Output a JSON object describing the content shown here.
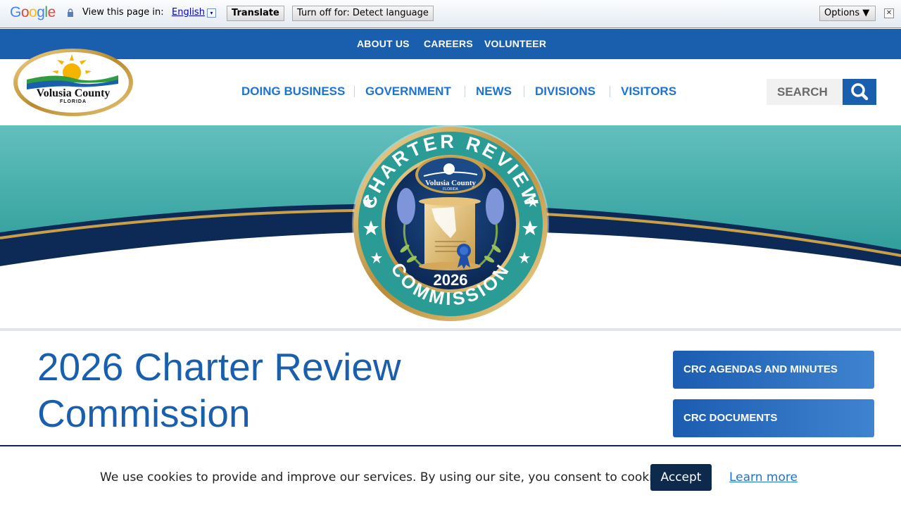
{
  "translate_bar": {
    "logo": "Google",
    "view_label": "View this page in:",
    "language": "English",
    "language_caret": "▾",
    "translate_button": "Translate",
    "turn_off_button": "Turn off for: Detect language",
    "options_button": "Options ▼",
    "close_glyph": "✕"
  },
  "utility_nav": {
    "items": [
      "ABOUT US",
      "CAREERS",
      "VOLUNTEER"
    ]
  },
  "header": {
    "logo_name": "Volusia County",
    "logo_state": "FLORIDA",
    "nav": [
      "DOING BUSINESS",
      "GOVERNMENT",
      "NEWS",
      "DIVISIONS",
      "VISITORS"
    ],
    "search_label": "SEARCH"
  },
  "hero": {
    "seal_top_text": "CHARTER REVIEW",
    "seal_bottom_text": "COMMISSION",
    "seal_year": "2026",
    "seal_logo_name": "Volusia County",
    "seal_logo_state": "FLORIDA"
  },
  "main": {
    "title_line1": "2026 Charter Review",
    "title_line2": "Commission",
    "side_buttons": [
      "CRC AGENDAS AND MINUTES",
      "CRC DOCUMENTS"
    ]
  },
  "cookie_banner": {
    "message": "We use cookies to provide and improve our services. By using our site, you consent to cookies.",
    "accept": "Accept",
    "learn_more": "Learn more"
  },
  "colors": {
    "brand_blue": "#1a5fae",
    "link_blue": "#1e73d2",
    "navy": "#0d2a4d",
    "teal": "#3aa9a7",
    "gold": "#c9a04a"
  }
}
